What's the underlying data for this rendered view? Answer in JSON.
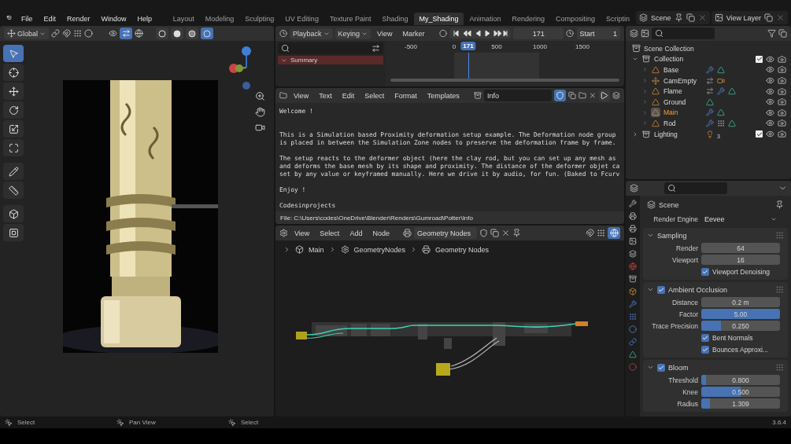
{
  "menu": [
    "File",
    "Edit",
    "Render",
    "Window",
    "Help"
  ],
  "workspaces": [
    {
      "label": "Layout",
      "selected": false
    },
    {
      "label": "Modeling",
      "selected": false
    },
    {
      "label": "Sculpting",
      "selected": false
    },
    {
      "label": "UV Editing",
      "selected": false
    },
    {
      "label": "Texture Paint",
      "selected": false
    },
    {
      "label": "Shading",
      "selected": false
    },
    {
      "label": "My_Shading",
      "selected": true
    },
    {
      "label": "Animation",
      "selected": false
    },
    {
      "label": "Rendering",
      "selected": false
    },
    {
      "label": "Compositing",
      "selected": false
    },
    {
      "label": "Scriptin",
      "selected": false
    }
  ],
  "scene": "Scene",
  "view_layer": "View Layer",
  "viewport": {
    "orientation": "Global",
    "shading": [
      {
        "kind": "wireframe",
        "selected": false
      },
      {
        "kind": "solid",
        "selected": false
      },
      {
        "kind": "material",
        "selected": false
      },
      {
        "kind": "rendered",
        "selected": true
      }
    ],
    "tools": [
      {
        "kind": "select",
        "selected": true
      },
      {
        "kind": "cursor",
        "selected": false
      },
      {
        "kind": "move",
        "selected": false
      },
      {
        "kind": "rotate",
        "selected": false
      },
      {
        "kind": "scale",
        "selected": false
      },
      {
        "kind": "transform",
        "selected": false
      },
      {
        "kind": "annotate",
        "selected": false
      },
      {
        "kind": "measure",
        "selected": false
      },
      {
        "kind": "add",
        "selected": false
      },
      {
        "kind": "extra",
        "selected": false
      }
    ]
  },
  "timeline": {
    "menus": [
      "Playback",
      "Keying",
      "View",
      "Marker"
    ],
    "current_frame": "171",
    "start_label": "Start",
    "start": "1",
    "channel": "Summary",
    "ruler": [
      "-500",
      "0",
      "500",
      "1000",
      "1500"
    ],
    "playhead": "171"
  },
  "text_editor": {
    "menus": [
      "View",
      "Text",
      "Edit",
      "Select",
      "Format",
      "Templates"
    ],
    "file_name": "Info",
    "paragraphs": [
      [
        "Welcome !"
      ],
      [
        "This is a Simulation based Proximity deformation setup example. The Deformation node group",
        "is placed in between the Simulation Zone nodes to preserve the deformation frame by frame."
      ],
      [
        "The setup reacts to the deformer object (here the clay rod, but you can set up any mesh as",
        "and deforms the base mesh by its shape and proximity. The distance of the deformer objet ca",
        "set by any value or keyframed manually. Here we drive it by audio, for fun. (Baked to Fcurv"
      ],
      [
        "Enjoy !"
      ],
      [
        "Codesinprojects"
      ]
    ],
    "file_path": "File: C:\\Users\\codes\\OneDrive\\Blender\\Renders\\Gumroad\\Potter\\Info"
  },
  "node_editor": {
    "menus": [
      "View",
      "Select",
      "Add",
      "Node"
    ],
    "node_group": "Geometry Nodes",
    "breadcrumbs": [
      "Main",
      "GeometryNodes",
      "Geometry Nodes"
    ]
  },
  "outliner": {
    "root": "Scene Collection",
    "items": [
      {
        "name": "Collection",
        "kind": "collection",
        "expanded": true,
        "checked": true,
        "selected": false,
        "children": [
          {
            "name": "Base",
            "kind": "mesh",
            "selected": false,
            "constraint": false,
            "modifier": true,
            "particles": false,
            "camera_data": false,
            "mesh_data": true
          },
          {
            "name": "CamEmpty",
            "kind": "empty",
            "selected": false,
            "constraint": true,
            "modifier": false,
            "particles": false,
            "camera_data": true,
            "mesh_data": false
          },
          {
            "name": "Flame",
            "kind": "mesh",
            "selected": false,
            "constraint": true,
            "modifier": true,
            "particles": false,
            "camera_data": false,
            "mesh_data": true
          },
          {
            "name": "Ground",
            "kind": "mesh",
            "selected": false,
            "constraint": false,
            "modifier": false,
            "particles": false,
            "camera_data": false,
            "mesh_data": true
          },
          {
            "name": "Main",
            "kind": "mesh",
            "selected": true,
            "constraint": false,
            "modifier": true,
            "particles": false,
            "camera_data": false,
            "mesh_data": true
          },
          {
            "name": "Rod",
            "kind": "mesh",
            "selected": false,
            "constraint": false,
            "modifier": true,
            "particles": true,
            "camera_data": false,
            "mesh_data": true
          }
        ]
      },
      {
        "name": "Lighting",
        "kind": "collection",
        "expanded": false,
        "checked": true,
        "selected": false,
        "light_count": "3"
      }
    ]
  },
  "properties": {
    "context": "Scene",
    "engine_label": "Render Engine",
    "engine": "Eevee",
    "panels": [
      {
        "title": "Sampling",
        "kind": "plain",
        "expanded": true,
        "rows": [
          {
            "kind": "number",
            "label": "Render",
            "value": "64"
          },
          {
            "kind": "number",
            "label": "Viewport",
            "value": "16"
          },
          {
            "kind": "checkbox",
            "label": "Viewport Denoising",
            "checked": true
          }
        ]
      },
      {
        "title": "Ambient Occlusion",
        "kind": "toggle",
        "checked": true,
        "expanded": true,
        "rows": [
          {
            "kind": "number",
            "label": "Distance",
            "value": "0.2 m"
          },
          {
            "kind": "slider",
            "label": "Factor",
            "value": "5.00",
            "level": 1
          },
          {
            "kind": "slider",
            "label": "Trace Precision",
            "value": "0.250",
            "level": 0.25
          },
          {
            "kind": "checkbox",
            "label": "Bent Normals",
            "checked": true
          },
          {
            "kind": "checkbox",
            "label": "Bounces Approxi...",
            "checked": true
          }
        ]
      },
      {
        "title": "Bloom",
        "kind": "toggle",
        "checked": true,
        "expanded": true,
        "rows": [
          {
            "kind": "slider",
            "label": "Threshold",
            "value": "0.800",
            "level": 0.06
          },
          {
            "kind": "slider",
            "label": "Knee",
            "value": "0.500",
            "level": 0.5
          },
          {
            "kind": "slider",
            "label": "Radius",
            "value": "1.309",
            "level": 0.11
          }
        ]
      }
    ]
  },
  "status": {
    "items": [
      "Select",
      "Pan View",
      "Select"
    ],
    "version": "3.6.4"
  }
}
